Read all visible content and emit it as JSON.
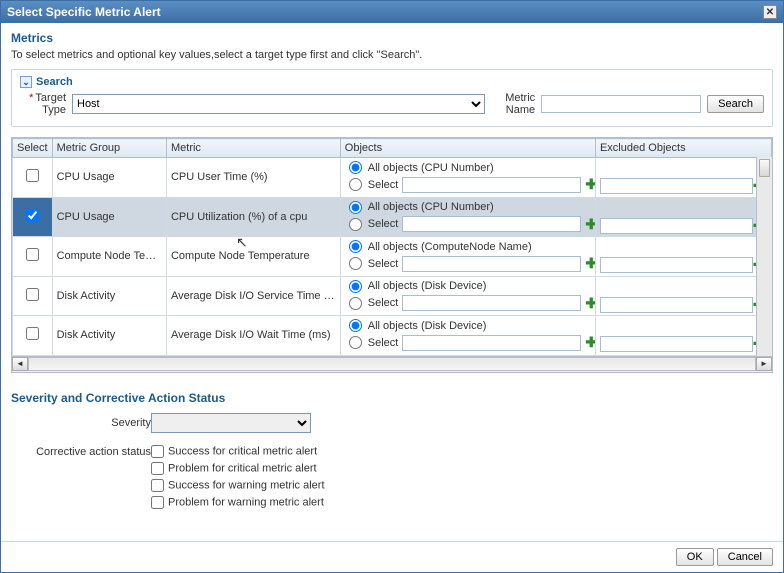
{
  "title": "Select Specific Metric Alert",
  "metrics": {
    "heading": "Metrics",
    "desc": "To select metrics and optional key values,select a target type first and click \"Search\"."
  },
  "search": {
    "heading": "Search",
    "target_type_label": "Target Type",
    "target_type_value": "Host",
    "metric_name_label": "Metric Name",
    "metric_name_value": "",
    "button": "Search"
  },
  "cols": {
    "select": "Select",
    "group": "Metric Group",
    "metric": "Metric",
    "objects": "Objects",
    "excluded": "Excluded Objects"
  },
  "obj_labels": {
    "select": "Select"
  },
  "rows": [
    {
      "selected": false,
      "group": "CPU Usage",
      "metric": "CPU User Time (%)",
      "all_label": "All objects (CPU Number)"
    },
    {
      "selected": true,
      "group": "CPU Usage",
      "metric": "CPU Utilization (%) of a cpu",
      "all_label": "All objects (CPU Number)"
    },
    {
      "selected": false,
      "group": "Compute Node Temperature",
      "metric": "Compute Node Temperature",
      "all_label": "All objects (ComputeNode Name)"
    },
    {
      "selected": false,
      "group": "Disk Activity",
      "metric": "Average Disk I/O Service Time (ms)",
      "all_label": "All objects (Disk Device)"
    },
    {
      "selected": false,
      "group": "Disk Activity",
      "metric": "Average Disk I/O Wait Time (ms)",
      "all_label": "All objects (Disk Device)"
    }
  ],
  "severity": {
    "heading": "Severity and Corrective Action Status",
    "label": "Severity",
    "value": ""
  },
  "ca": {
    "label": "Corrective action status",
    "opts": [
      "Success for critical metric alert",
      "Problem for critical metric alert",
      "Success for warning metric alert",
      "Problem for warning metric alert"
    ]
  },
  "footer": {
    "ok": "OK",
    "cancel": "Cancel"
  }
}
